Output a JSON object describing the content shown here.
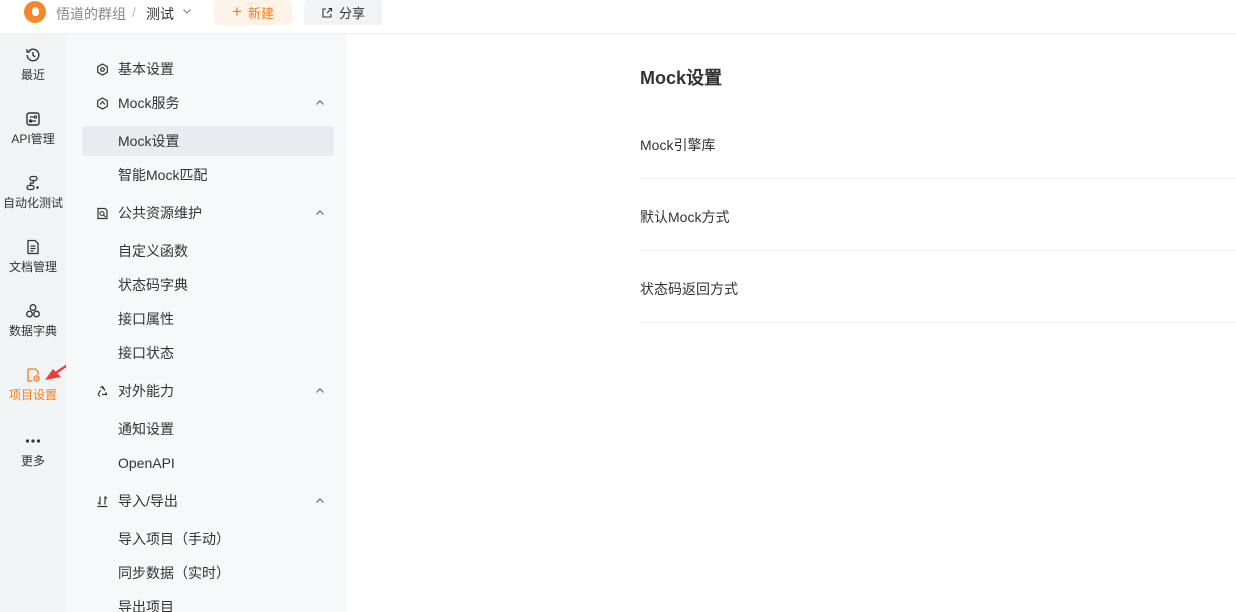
{
  "topbar": {
    "team": "悟道的群组",
    "separator": "/",
    "project": "测试",
    "new_label": "新建",
    "share_label": "分享",
    "accent": "#f27d1f"
  },
  "rail": {
    "items": [
      {
        "label": "最近",
        "icon": "clock-icon"
      },
      {
        "label": "API管理",
        "icon": "api-icon"
      },
      {
        "label": "自动化测试",
        "icon": "flow-icon"
      },
      {
        "label": "文档管理",
        "icon": "doc-icon"
      },
      {
        "label": "数据字典",
        "icon": "dictionary-icon"
      },
      {
        "label": "项目设置",
        "icon": "project-settings-icon",
        "active": true
      },
      {
        "label": "更多",
        "icon": "more-icon"
      }
    ]
  },
  "nav": {
    "basic": "基本设置",
    "mock_service": "Mock服务",
    "mock_settings": "Mock设置",
    "smart_mock": "智能Mock匹配",
    "public_resource": "公共资源维护",
    "custom_function": "自定义函数",
    "status_code_dict": "状态码字典",
    "api_attribute": "接口属性",
    "api_status": "接口状态",
    "external": "对外能力",
    "notification": "通知设置",
    "openapi": "OpenAPI",
    "import_export": "导入/导出",
    "import_manual": "导入项目（手动）",
    "sync_realtime": "同步数据（实时）",
    "export_project": "导出项目"
  },
  "main": {
    "title": "Mock设置",
    "rows": [
      "Mock引擎库",
      "默认Mock方式",
      "状态码返回方式"
    ]
  }
}
